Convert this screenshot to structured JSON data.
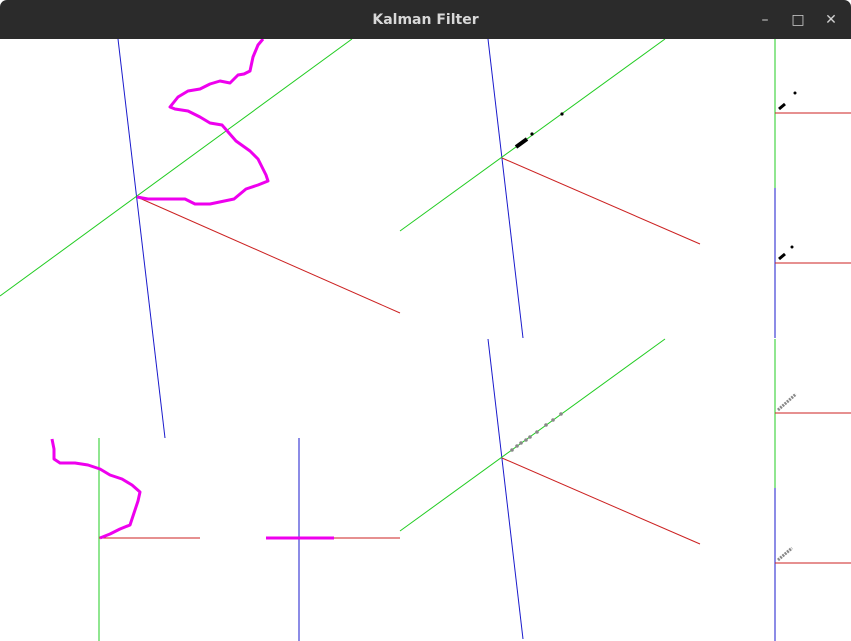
{
  "window": {
    "title": "Kalman Filter",
    "minimize_glyph": "–",
    "maximize_glyph": "□",
    "close_glyph": "✕"
  },
  "colors": {
    "titlebar": "#2b2b2b",
    "title_text": "#d8d8d8",
    "background": "#ffffff",
    "axis_x": "#cc2222",
    "axis_y": "#22cc22",
    "axis_z": "#1a1acc",
    "trajectory": "#ee00ee",
    "samples_dark": "#000000",
    "samples_gray": "#888888"
  }
}
